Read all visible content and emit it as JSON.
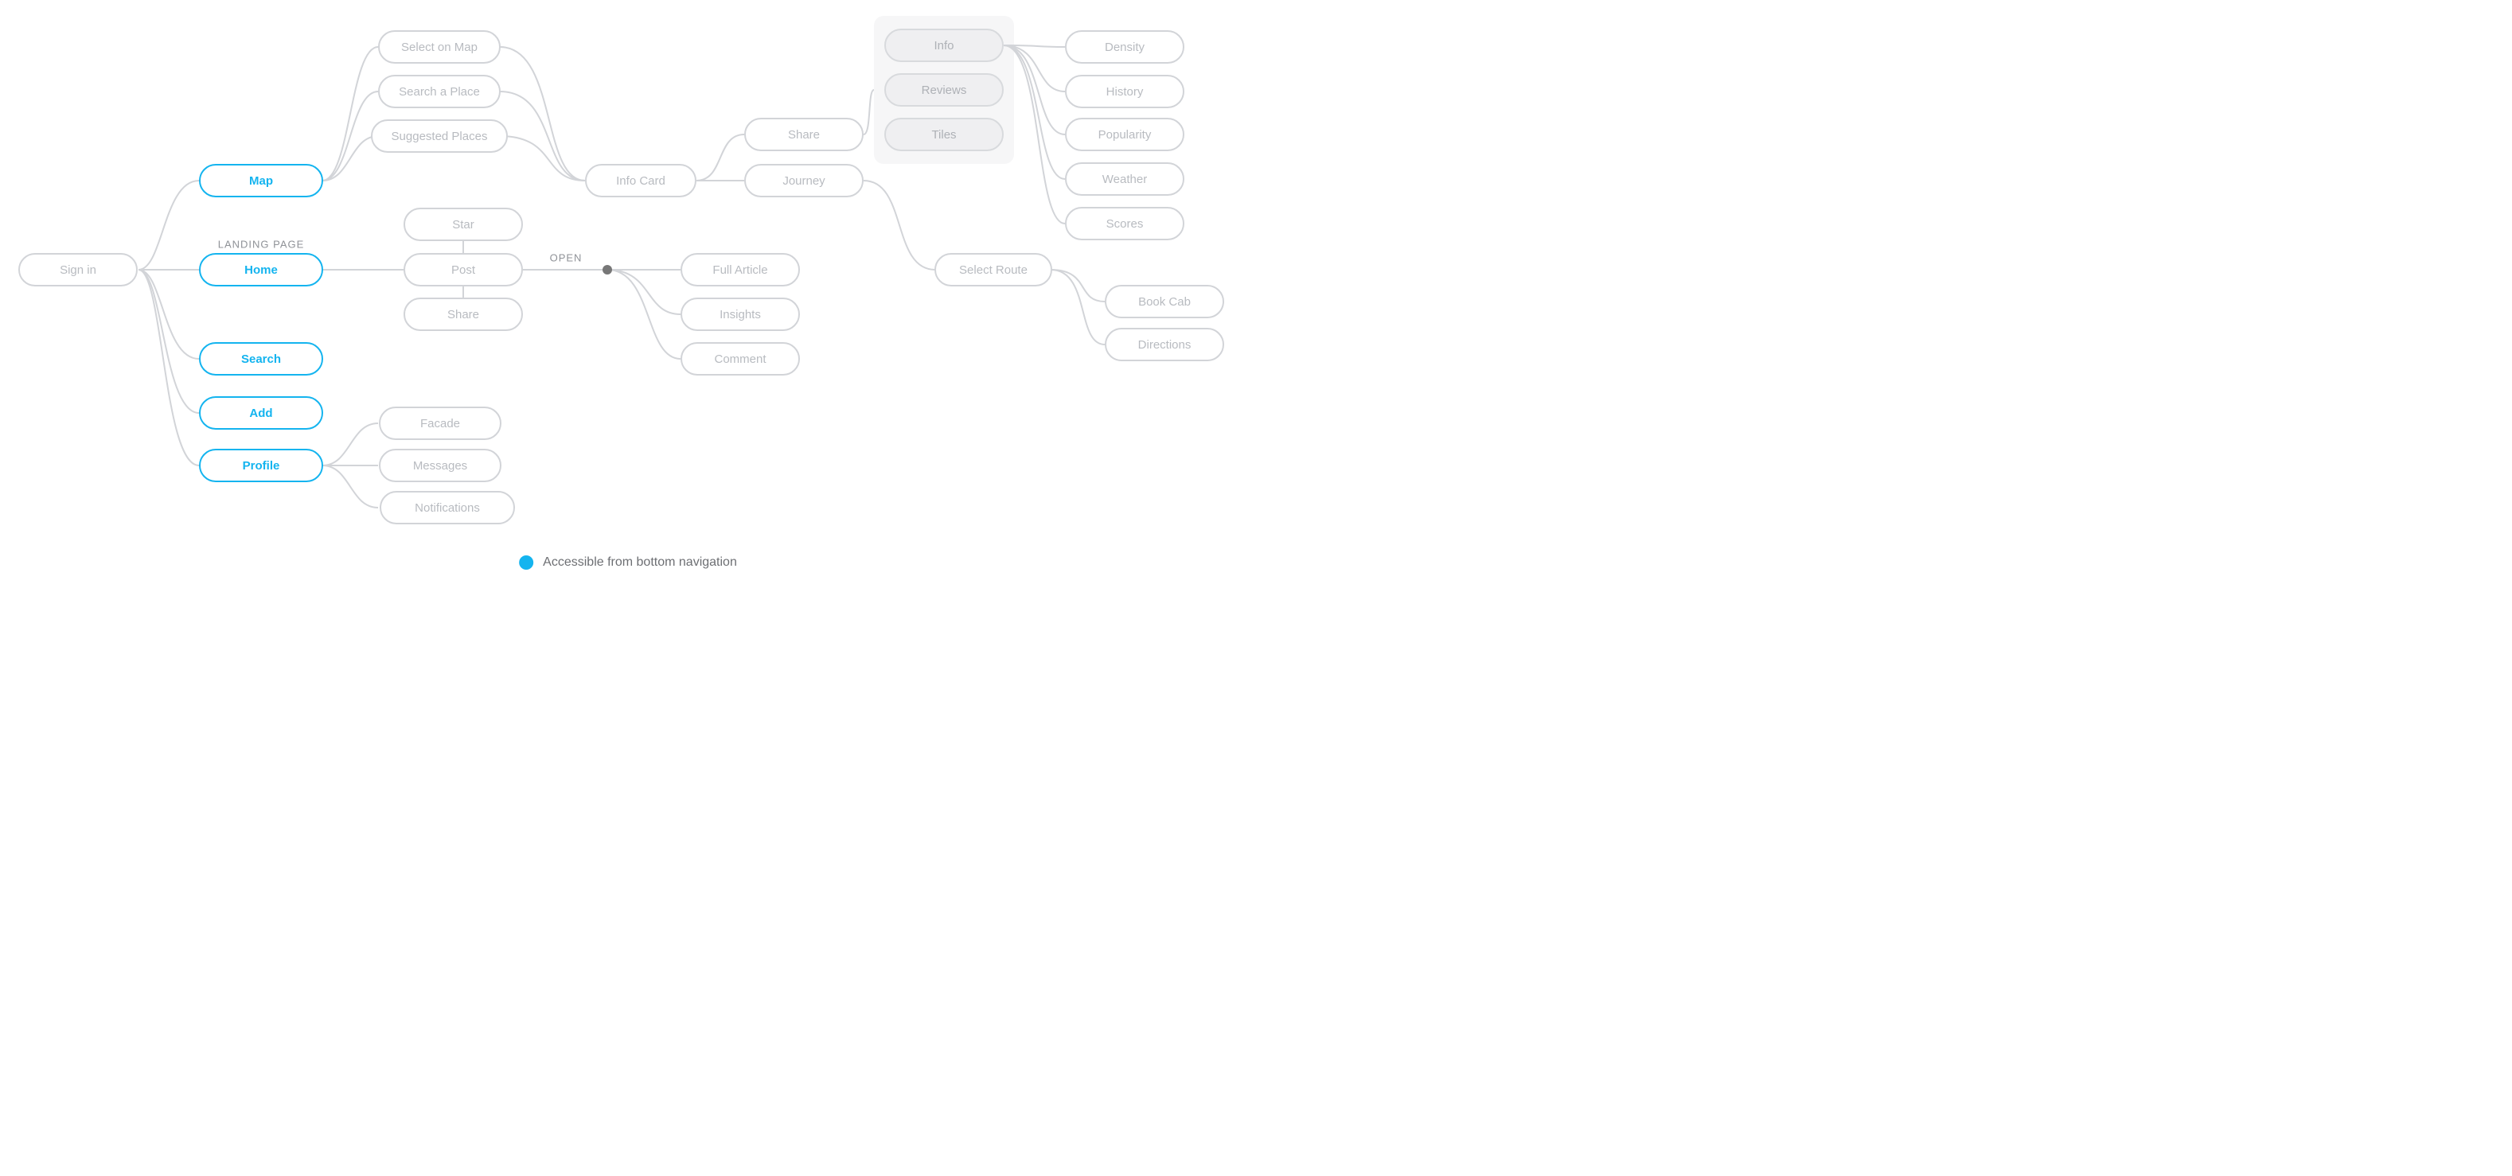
{
  "colors": {
    "accent": "#14b4ef",
    "node_border": "#d2d4d8",
    "node_text": "#b8bbc0",
    "tab_bg": "#efeff1",
    "panel_bg": "#f6f6f7",
    "connector": "#d2d4d8",
    "dot": "#777777"
  },
  "annotations": {
    "landing_page": "LANDING PAGE",
    "open": "OPEN"
  },
  "legend": {
    "label": "Accessible from bottom navigation"
  },
  "nodes": {
    "sign_in": "Sign in",
    "map": "Map",
    "home": "Home",
    "search": "Search",
    "add": "Add",
    "profile": "Profile",
    "select_on_map": "Select on Map",
    "search_a_place": "Search a Place",
    "suggested_places": "Suggested Places",
    "star": "Star",
    "post": "Post",
    "share_post": "Share",
    "facade": "Facade",
    "messages": "Messages",
    "notifications": "Notifications",
    "info_card": "Info Card",
    "share_card": "Share",
    "journey": "Journey",
    "full_article": "Full Article",
    "insights": "Insights",
    "comment": "Comment",
    "tab_info": "Info",
    "tab_reviews": "Reviews",
    "tab_tiles": "Tiles",
    "density": "Density",
    "history": "History",
    "popularity": "Popularity",
    "weather": "Weather",
    "scores": "Scores",
    "select_route": "Select Route",
    "book_cab": "Book Cab",
    "directions": "Directions"
  }
}
